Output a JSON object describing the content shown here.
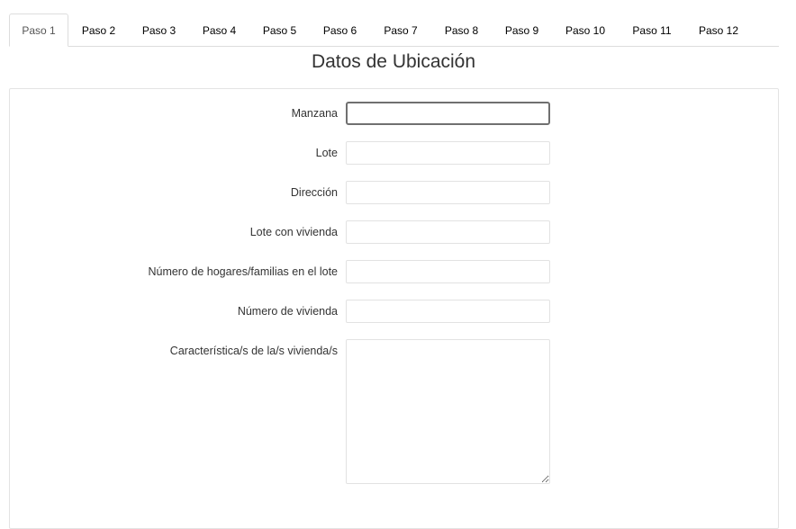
{
  "tabs": [
    {
      "label": "Paso 1",
      "active": true
    },
    {
      "label": "Paso 2",
      "active": false
    },
    {
      "label": "Paso 3",
      "active": false
    },
    {
      "label": "Paso 4",
      "active": false
    },
    {
      "label": "Paso 5",
      "active": false
    },
    {
      "label": "Paso 6",
      "active": false
    },
    {
      "label": "Paso 7",
      "active": false
    },
    {
      "label": "Paso 8",
      "active": false
    },
    {
      "label": "Paso 9",
      "active": false
    },
    {
      "label": "Paso 10",
      "active": false
    },
    {
      "label": "Paso 11",
      "active": false
    },
    {
      "label": "Paso 12",
      "active": false
    }
  ],
  "form": {
    "title": "Datos de Ubicación",
    "fields": [
      {
        "label": "Manzana",
        "value": ""
      },
      {
        "label": "Lote",
        "value": ""
      },
      {
        "label": "Dirección",
        "value": ""
      },
      {
        "label": "Lote con vivienda",
        "value": ""
      },
      {
        "label": "Número de hogares/familias en el lote",
        "value": ""
      },
      {
        "label": "Número de vivienda",
        "value": ""
      },
      {
        "label": "Característica/s de la/s vivienda/s",
        "value": ""
      }
    ]
  },
  "colors": {
    "tab_border": "#dddddd",
    "field_border": "#e2e2e2",
    "focus_border": "#707070"
  }
}
